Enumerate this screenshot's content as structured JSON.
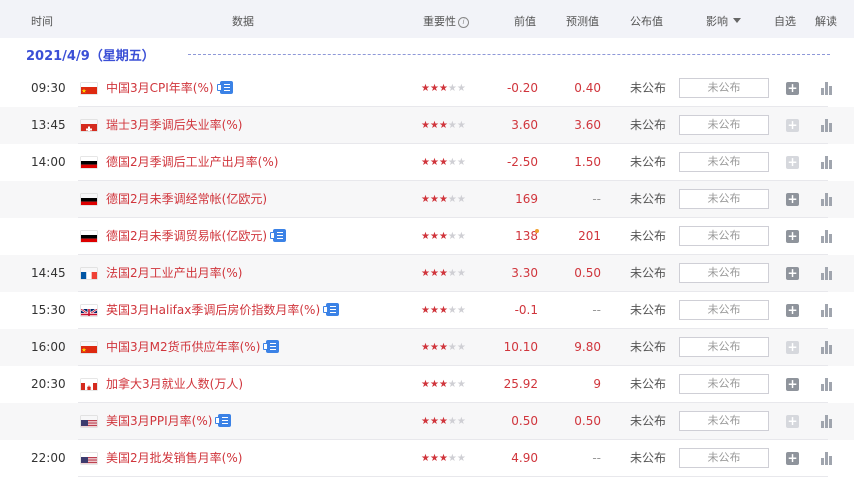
{
  "header": {
    "time": "时间",
    "data": "数据",
    "importance": "重要性",
    "previous": "前值",
    "forecast": "预测值",
    "published": "公布值",
    "impact": "影响",
    "watchlist": "自选",
    "interpret": "解读"
  },
  "date_label": "2021/4/9（星期五）",
  "rows": [
    {
      "time": "09:30",
      "flag": "china-flag-icon",
      "name": "中国3月CPI年率(%)",
      "doc": true,
      "stars": 3,
      "prev": "-0.20",
      "fcst": "0.40",
      "pub": "未公布",
      "impact": "未公布",
      "watch_enabled": true
    },
    {
      "time": "13:45",
      "flag": "switzerland-flag-icon",
      "name": "瑞士3月季调后失业率(%)",
      "doc": false,
      "stars": 3,
      "prev": "3.60",
      "fcst": "3.60",
      "pub": "未公布",
      "impact": "未公布",
      "watch_enabled": false
    },
    {
      "time": "14:00",
      "flag": "germany-flag-icon",
      "name": "德国2月季调后工业产出月率(%)",
      "doc": false,
      "stars": 3,
      "prev": "-2.50",
      "fcst": "1.50",
      "pub": "未公布",
      "impact": "未公布",
      "watch_enabled": false
    },
    {
      "time": "",
      "flag": "germany-flag-icon",
      "name": "德国2月未季调经常帐(亿欧元)",
      "doc": false,
      "stars": 3,
      "prev": "169",
      "fcst": "--",
      "pub": "未公布",
      "impact": "未公布",
      "watch_enabled": true
    },
    {
      "time": "",
      "flag": "germany-flag-icon",
      "name": "德国2月未季调贸易帐(亿欧元)",
      "doc": true,
      "stars": 3,
      "prev": "138",
      "fcst": "201",
      "pub": "未公布",
      "impact": "未公布",
      "watch_enabled": true
    },
    {
      "time": "14:45",
      "flag": "france-flag-icon",
      "name": "法国2月工业产出月率(%)",
      "doc": false,
      "stars": 3,
      "prev": "3.30",
      "fcst": "0.50",
      "pub": "未公布",
      "impact": "未公布",
      "watch_enabled": true
    },
    {
      "time": "15:30",
      "flag": "uk-flag-icon",
      "name": "英国3月Halifax季调后房价指数月率(%)",
      "doc": true,
      "stars": 3,
      "prev": "-0.1",
      "fcst": "--",
      "pub": "未公布",
      "impact": "未公布",
      "watch_enabled": true
    },
    {
      "time": "16:00",
      "flag": "china-flag-icon",
      "name": "中国3月M2货币供应年率(%)",
      "doc": true,
      "stars": 3,
      "prev": "10.10",
      "fcst": "9.80",
      "pub": "未公布",
      "impact": "未公布",
      "watch_enabled": false
    },
    {
      "time": "20:30",
      "flag": "canada-flag-icon",
      "name": "加拿大3月就业人数(万人)",
      "doc": false,
      "stars": 3,
      "prev": "25.92",
      "fcst": "9",
      "pub": "未公布",
      "impact": "未公布",
      "watch_enabled": true
    },
    {
      "time": "",
      "flag": "usa-flag-icon",
      "name": "美国3月PPI月率(%)",
      "doc": true,
      "stars": 3,
      "prev": "0.50",
      "fcst": "0.50",
      "pub": "未公布",
      "impact": "未公布",
      "watch_enabled": false
    },
    {
      "time": "22:00",
      "flag": "usa-flag-icon",
      "name": "美国2月批发销售月率(%)",
      "doc": false,
      "stars": 3,
      "prev": "4.90",
      "fcst": "--",
      "pub": "未公布",
      "impact": "未公布",
      "watch_enabled": true
    }
  ],
  "colors": {
    "accent_red": "#d0353c",
    "date_blue": "#3b4fd6",
    "header_bg": "#f2f3f8"
  }
}
